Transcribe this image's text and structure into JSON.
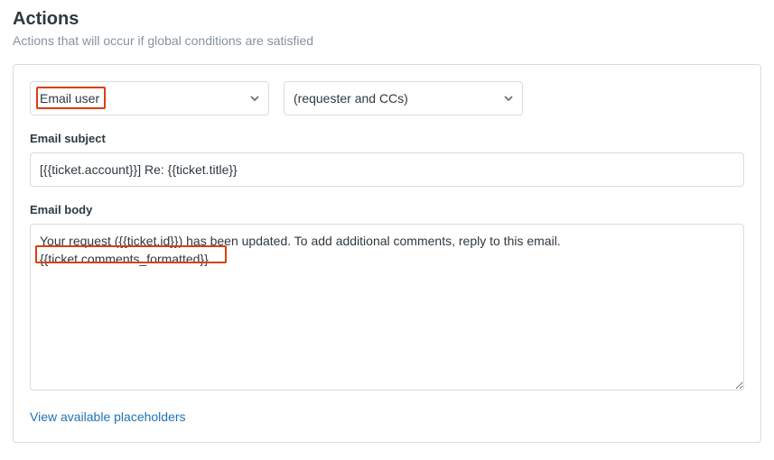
{
  "header": {
    "title": "Actions",
    "subtitle": "Actions that will occur if global conditions are satisfied"
  },
  "action": {
    "type_selected": "Email user",
    "target_selected": "(requester and CCs)"
  },
  "email_subject": {
    "label": "Email subject",
    "value": "[{{ticket.account}}] Re: {{ticket.title}}"
  },
  "email_body": {
    "label": "Email body",
    "value": "Your request ({{ticket.id}}) has been updated. To add additional comments, reply to this email.\n{{ticket.comments_formatted}}"
  },
  "footer": {
    "placeholders_link": "View available placeholders"
  }
}
